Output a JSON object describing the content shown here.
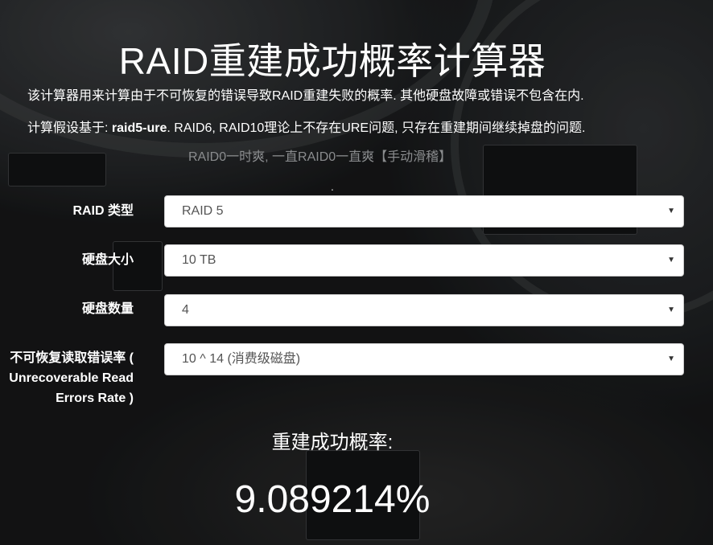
{
  "title": "RAID重建成功概率计算器",
  "description_line1": "该计算器用来计算由于不可恢复的错误导致RAID重建失败的概率. 其他硬盘故障或错误不包含在内.",
  "description_line2_prefix": "计算假设基于: ",
  "description_line2_bold": "raid5-ure",
  "description_line2_suffix": ". RAID6, RAID10理论上不存在URE问题, 只存在重建期间继续掉盘的问题.",
  "note": "RAID0一时爽, 一直RAID0一直爽【手动滑稽】",
  "dot": ".",
  "form": {
    "raid_type": {
      "label": "RAID 类型",
      "value": "RAID 5"
    },
    "disk_size": {
      "label": "硬盘大小",
      "value": "10 TB"
    },
    "disk_count": {
      "label": "硬盘数量",
      "value": "4"
    },
    "ure_rate": {
      "label_line1": "不可恢复读取错误率 (",
      "label_line2": "Unrecoverable Read",
      "label_line3": "Errors Rate )",
      "value": "10 ^ 14 (消费级磁盘)"
    }
  },
  "result": {
    "label": "重建成功概率:",
    "value": "9.089214%"
  },
  "icons": {
    "select_arrow": "chevron-down-icon"
  }
}
